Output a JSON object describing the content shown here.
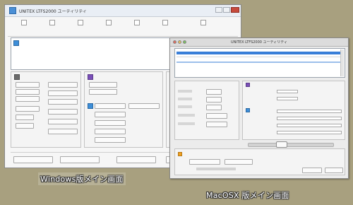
{
  "windows_window": {
    "title": "UNITEX LTFS2000 ユーティリティ",
    "toolbar_items": [
      "",
      "",
      "",
      "",
      "",
      "",
      ""
    ],
    "section_headers": [
      "",
      "",
      ""
    ],
    "footer_buttons": [
      "",
      "",
      "",
      ""
    ]
  },
  "mac_window": {
    "title": "UNITEX LTFS2000 ユーティリティ",
    "section_headers": [
      "",
      "",
      ""
    ],
    "bottom_label": ""
  },
  "captions": {
    "windows": "Windows版メイン画面",
    "mac": "MacOSX 版メイン画面"
  },
  "colors": {
    "selection": "#3a7fd8",
    "format_icon": "#7a4fb8",
    "tool_icon": "#f0a020",
    "info_icon": "#3d8ed8"
  }
}
